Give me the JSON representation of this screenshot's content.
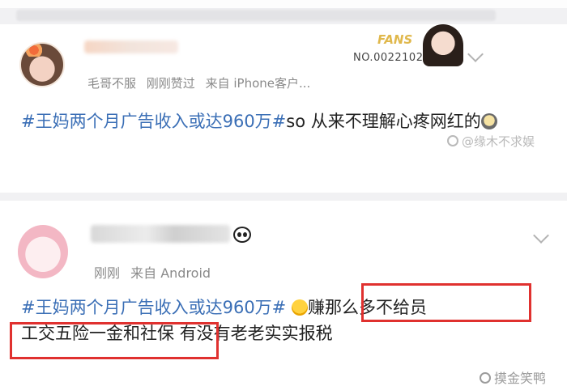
{
  "post1": {
    "meta": {
      "device_from": "毛哥不服",
      "time": "刚刚赞过",
      "source": "来自 iPhone客户..."
    },
    "fans_badge": {
      "title": "FANS",
      "number": "NO.0022102"
    },
    "text_topic": "#王妈两个月广告收入或达960万#",
    "text_rest": "so 从来不理解心疼网红的",
    "watermark": "@缘木不求娱"
  },
  "post2": {
    "meta": {
      "time": "刚刚",
      "source": "来自 Android"
    },
    "text_topic": "#王妈两个月广告收入或达960万#",
    "text_part1": "赚那么多不给员",
    "text_part2": "工交五险一金和社保",
    "text_part3": "有没有老老实实报税",
    "watermark": "摸金笑鸭"
  },
  "colors": {
    "topic": "#3b6fb6",
    "highlight_box": "#e0312f"
  }
}
